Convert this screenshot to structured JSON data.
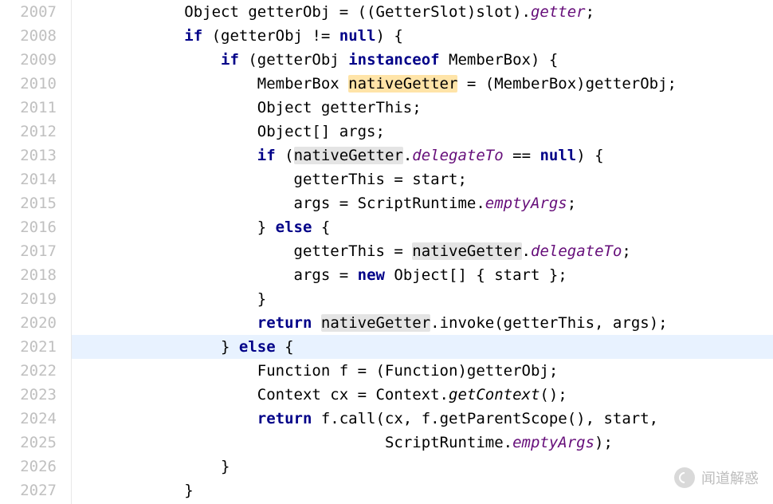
{
  "startLine": 2007,
  "currentLine": 2021,
  "highlightedVar": "nativeGetter",
  "lines": [
    {
      "indent": "            ",
      "tokens": [
        {
          "t": "Object getterObj = ((GetterSlot)slot)."
        },
        {
          "t": "getter",
          "cls": "fld"
        },
        {
          "t": ";"
        }
      ]
    },
    {
      "indent": "            ",
      "tokens": [
        {
          "t": "if",
          "cls": "kw"
        },
        {
          "t": " (getterObj != "
        },
        {
          "t": "null",
          "cls": "kw"
        },
        {
          "t": ") {"
        }
      ]
    },
    {
      "indent": "                ",
      "tokens": [
        {
          "t": "if",
          "cls": "kw"
        },
        {
          "t": " (getterObj "
        },
        {
          "t": "instanceof",
          "cls": "kw"
        },
        {
          "t": " MemberBox) {"
        }
      ]
    },
    {
      "indent": "                    ",
      "tokens": [
        {
          "t": "MemberBox "
        },
        {
          "t": "nativeGetter",
          "cls": "hl-def"
        },
        {
          "t": " = (MemberBox)getterObj;"
        }
      ]
    },
    {
      "indent": "                    ",
      "tokens": [
        {
          "t": "Object getterThis;"
        }
      ]
    },
    {
      "indent": "                    ",
      "tokens": [
        {
          "t": "Object[] args;"
        }
      ]
    },
    {
      "indent": "                    ",
      "tokens": [
        {
          "t": "if",
          "cls": "kw"
        },
        {
          "t": " ("
        },
        {
          "t": "nativeGetter",
          "cls": "hl-use"
        },
        {
          "t": "."
        },
        {
          "t": "delegateTo",
          "cls": "fld"
        },
        {
          "t": " == "
        },
        {
          "t": "null",
          "cls": "kw"
        },
        {
          "t": ") {"
        }
      ]
    },
    {
      "indent": "                        ",
      "tokens": [
        {
          "t": "getterThis = start;"
        }
      ]
    },
    {
      "indent": "                        ",
      "tokens": [
        {
          "t": "args = ScriptRuntime."
        },
        {
          "t": "emptyArgs",
          "cls": "fld"
        },
        {
          "t": ";"
        }
      ]
    },
    {
      "indent": "                    ",
      "tokens": [
        {
          "t": "} "
        },
        {
          "t": "else",
          "cls": "kw"
        },
        {
          "t": " {"
        }
      ]
    },
    {
      "indent": "                        ",
      "tokens": [
        {
          "t": "getterThis = "
        },
        {
          "t": "nativeGetter",
          "cls": "hl-use"
        },
        {
          "t": "."
        },
        {
          "t": "delegateTo",
          "cls": "fld"
        },
        {
          "t": ";"
        }
      ]
    },
    {
      "indent": "                        ",
      "tokens": [
        {
          "t": "args = "
        },
        {
          "t": "new",
          "cls": "kw"
        },
        {
          "t": " Object[] { start };"
        }
      ]
    },
    {
      "indent": "                    ",
      "tokens": [
        {
          "t": "}"
        }
      ]
    },
    {
      "indent": "                    ",
      "tokens": [
        {
          "t": "return",
          "cls": "kw"
        },
        {
          "t": " "
        },
        {
          "t": "nativeGetter",
          "cls": "hl-use"
        },
        {
          "t": ".invoke(getterThis, args);"
        }
      ]
    },
    {
      "indent": "                ",
      "tokens": [
        {
          "t": "} "
        },
        {
          "t": "else",
          "cls": "kw"
        },
        {
          "t": " {"
        }
      ]
    },
    {
      "indent": "                    ",
      "tokens": [
        {
          "t": "Function f = (Function)getterObj;"
        }
      ]
    },
    {
      "indent": "                    ",
      "tokens": [
        {
          "t": "Context cx = Context."
        },
        {
          "t": "getContext",
          "cls": "stat"
        },
        {
          "t": "();"
        }
      ]
    },
    {
      "indent": "                    ",
      "tokens": [
        {
          "t": "return",
          "cls": "kw"
        },
        {
          "t": " f.call(cx, f.getParentScope(), start,"
        }
      ]
    },
    {
      "indent": "                                  ",
      "tokens": [
        {
          "t": "ScriptRuntime."
        },
        {
          "t": "emptyArgs",
          "cls": "fld"
        },
        {
          "t": ");"
        }
      ]
    },
    {
      "indent": "                ",
      "tokens": [
        {
          "t": "}"
        }
      ]
    },
    {
      "indent": "            ",
      "tokens": [
        {
          "t": "}"
        }
      ]
    }
  ],
  "watermark": "闻道解惑"
}
